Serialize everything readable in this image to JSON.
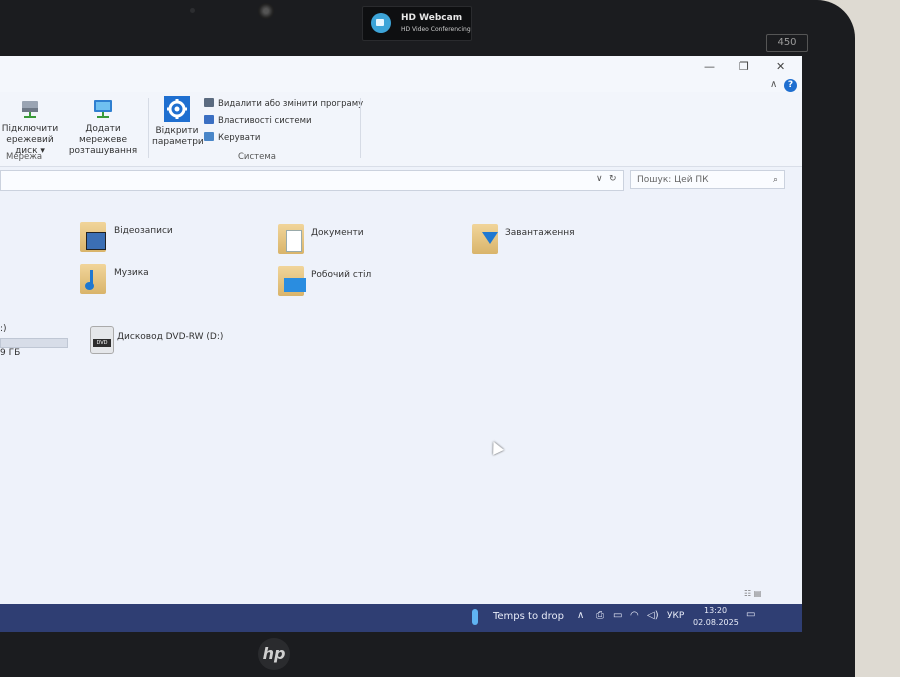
{
  "hardware": {
    "webcam_badge_title": "HD Webcam",
    "webcam_badge_subtitle": "HD Video Conferencing",
    "model_label": "450",
    "brand_logo": "hp"
  },
  "window": {
    "controls": {
      "minimize": "—",
      "maximize": "❐",
      "close": "✕"
    },
    "help": "?",
    "ribbon": {
      "network_group": {
        "label": "Мережа",
        "buttons": [
          {
            "label_line1": "Підключити",
            "label_line2": "ережевий диск ▾",
            "icon": "network-drive-icon"
          },
          {
            "label_line1": "Додати мережеве",
            "label_line2": "розташування",
            "icon": "network-location-icon"
          }
        ]
      },
      "system_group": {
        "label": "Система",
        "open_settings": {
          "label_line1": "Відкрити",
          "label_line2": "параметри",
          "icon": "gear-icon"
        },
        "small_items": [
          {
            "label": "Видалити або змінити програму",
            "icon": "uninstall-icon"
          },
          {
            "label": "Властивості системи",
            "icon": "system-properties-icon"
          },
          {
            "label": "Керувати",
            "icon": "manage-icon"
          }
        ]
      }
    },
    "address_bar": {
      "dropdown": "∨",
      "refresh": "↻"
    },
    "search": {
      "placeholder": "Пошук: Цей ПК"
    },
    "folders": [
      {
        "name": "Відеозаписи",
        "icon": "videos-folder-icon"
      },
      {
        "name": "Документи",
        "icon": "documents-folder-icon"
      },
      {
        "name": "Завантаження",
        "icon": "downloads-folder-icon"
      },
      {
        "name": "Музика",
        "icon": "music-folder-icon"
      },
      {
        "name": "Робочий стіл",
        "icon": "desktop-folder-icon"
      }
    ],
    "drives": {
      "partial_drive_label": ":)",
      "partial_drive_size": "9 ГБ",
      "dvd_label": "Дисковод DVD-RW (D:)",
      "dvd_icon_text": "DVD"
    }
  },
  "taskbar": {
    "weather": "Temps to drop",
    "language": "УКР",
    "time": "13:20",
    "date": "02.08.2025",
    "tray_icons": [
      "chevron-up-icon",
      "usb-icon",
      "battery-icon",
      "wifi-icon",
      "volume-icon"
    ]
  }
}
